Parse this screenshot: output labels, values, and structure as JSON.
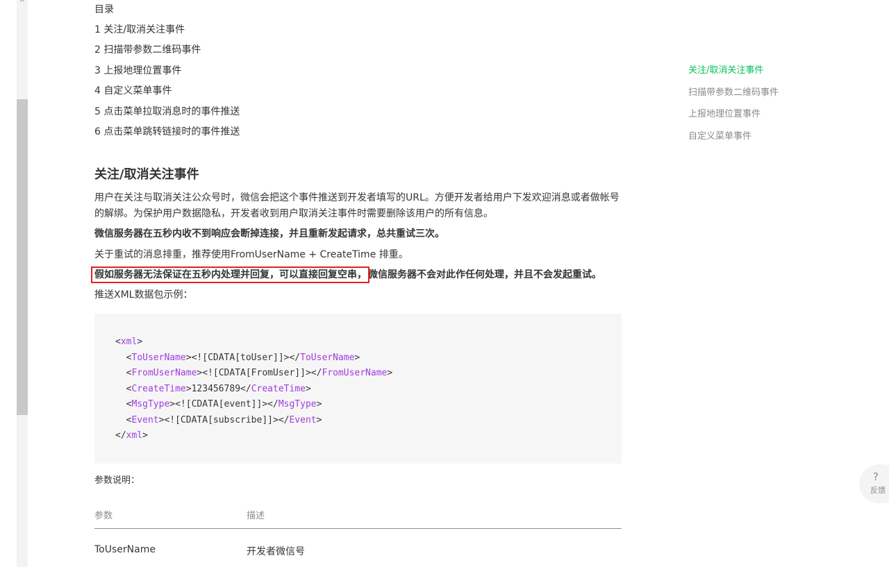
{
  "toc": {
    "title": "目录",
    "items": [
      "1 关注/取消关注事件",
      "2 扫描带参数二维码事件",
      "3 上报地理位置事件",
      "4 自定义菜单事件",
      "5 点击菜单拉取消息时的事件推送",
      "6 点击菜单跳转链接时的事件推送"
    ]
  },
  "section": {
    "title": "关注/取消关注事件",
    "p1": "用户在关注与取消关注公众号时，微信会把这个事件推送到开发者填写的URL。方便开发者给用户下发欢迎消息或者做帐号的解绑。为保护用户数据隐私，开发者收到用户取消关注事件时需要删除该用户的所有信息。",
    "p2": "微信服务器在五秒内收不到响应会断掉连接，并且重新发起请求，总共重试三次。",
    "p3": "关于重试的消息排重，推荐使用FromUserName + CreateTime 排重。",
    "p4_highlighted": "假如服务器无法保证在五秒内处理并回复，可以直接回复空串，",
    "p4_rest": "微信服务器不会对此作任何处理，并且不会发起重试。",
    "p5": "推送XML数据包示例："
  },
  "code": {
    "lines": [
      {
        "indent": "",
        "open": "xml",
        "value": "",
        "close": ""
      },
      {
        "indent": "  ",
        "open": "ToUserName",
        "value": "<![CDATA[toUser]]>",
        "close": "ToUserName"
      },
      {
        "indent": "  ",
        "open": "FromUserName",
        "value": "<![CDATA[FromUser]]>",
        "close": "FromUserName"
      },
      {
        "indent": "  ",
        "open": "CreateTime",
        "value": "123456789",
        "close": "CreateTime"
      },
      {
        "indent": "  ",
        "open": "MsgType",
        "value": "<![CDATA[event]]>",
        "close": "MsgType"
      },
      {
        "indent": "  ",
        "open": "Event",
        "value": "<![CDATA[subscribe]]>",
        "close": "Event"
      },
      {
        "indent": "",
        "open": "",
        "value": "",
        "close": "xml"
      }
    ]
  },
  "params": {
    "title": "参数说明：",
    "headers": [
      "参数",
      "描述"
    ],
    "rows": [
      [
        "ToUserName",
        "开发者微信号"
      ]
    ]
  },
  "right_toc": {
    "items": [
      "关注/取消关注事件",
      "扫描带参数二维码事件",
      "上报地理位置事件",
      "自定义菜单事件"
    ],
    "active_index": 0
  },
  "feedback": {
    "icon": "question-mark-icon",
    "glyph": "?",
    "label": "反馈"
  },
  "colors": {
    "accent": "#07c160",
    "highlight_border": "#e02020",
    "xml_tag": "#a03ce0"
  }
}
